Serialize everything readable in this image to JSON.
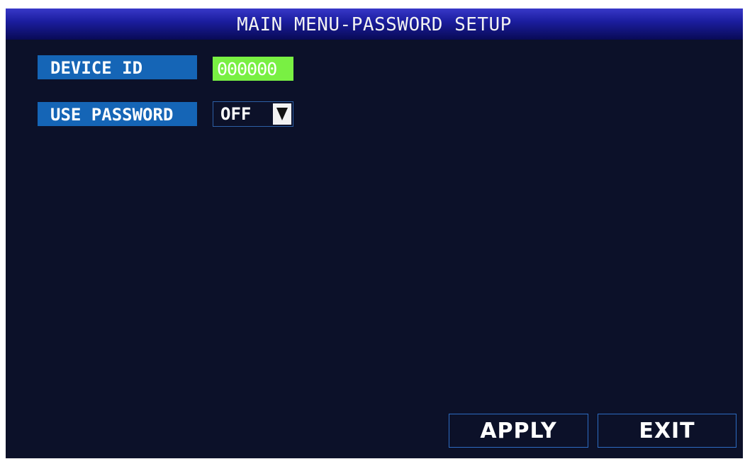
{
  "header": {
    "title": "MAIN MENU-PASSWORD SETUP"
  },
  "fields": {
    "device_id": {
      "label": "DEVICE ID",
      "value": "000000"
    },
    "use_password": {
      "label": "USE PASSWORD",
      "value": "OFF"
    }
  },
  "buttons": {
    "apply": "APPLY",
    "exit": "EXIT"
  },
  "colors": {
    "background": "#0c1129",
    "title_gradient_top": "#3838c8",
    "title_gradient_bottom": "#080a55",
    "label_bg": "#1565b6",
    "id_field_bg": "#79f043",
    "button_border": "#2d6cc2"
  }
}
